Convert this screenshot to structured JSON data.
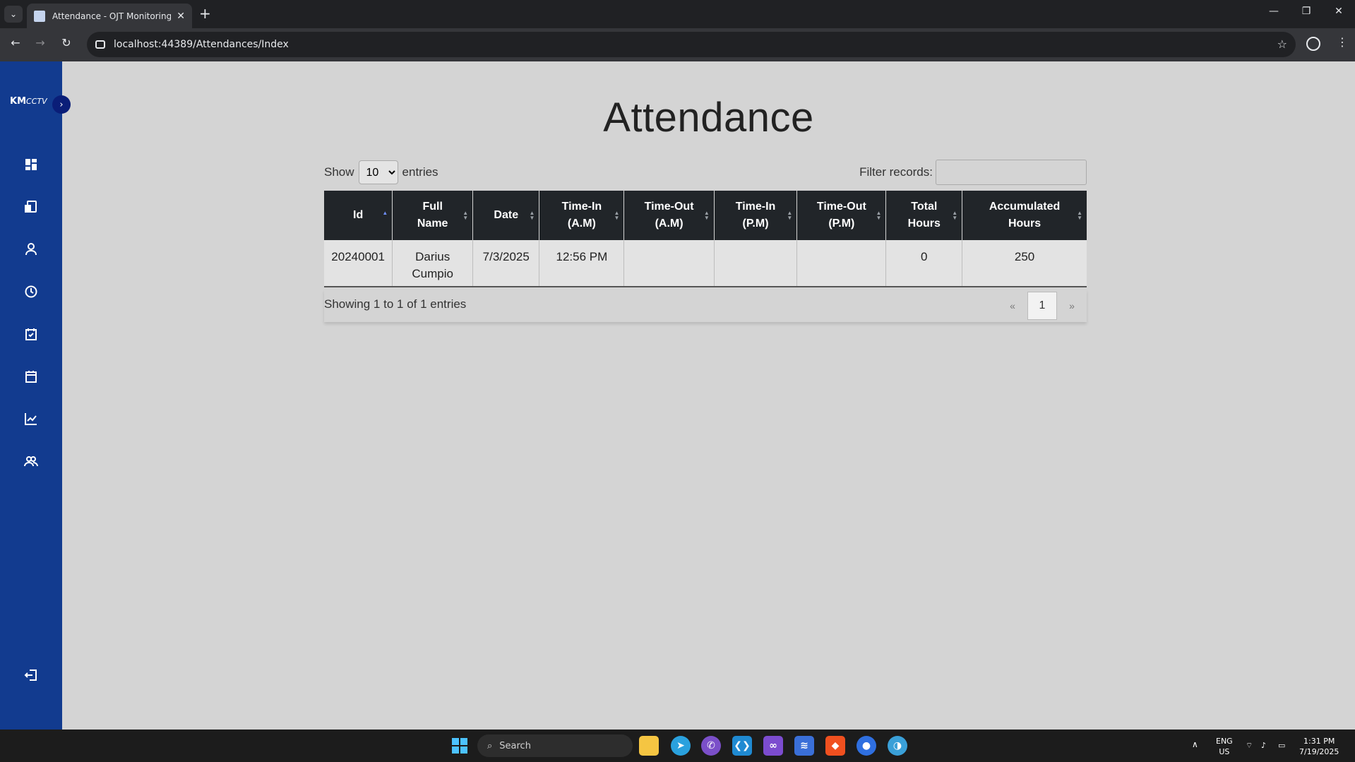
{
  "browser": {
    "tab_title": "Attendance - OJT Monitoring S",
    "url": "localhost:44389/Attendances/Index",
    "new_tab": "+",
    "tab_close": "✕"
  },
  "sidebar": {
    "logo_main": "KM",
    "logo_sub": "CCTV",
    "expand": "›",
    "items": [
      {
        "name": "dashboard-icon"
      },
      {
        "name": "report-icon"
      },
      {
        "name": "user-icon"
      },
      {
        "name": "clock-icon"
      },
      {
        "name": "calendar-check-icon"
      },
      {
        "name": "clipboard-icon"
      },
      {
        "name": "chart-line-icon"
      },
      {
        "name": "users-icon"
      },
      {
        "name": "logout-icon"
      }
    ],
    "bg_color": "#123b8f"
  },
  "page": {
    "title": "Attendance",
    "show_label": "Show",
    "entries_label": "entries",
    "length_value": "10",
    "filter_label": "Filter records:",
    "filter_value": "",
    "info": "Showing 1 to 1 of 1 entries"
  },
  "table": {
    "headers": [
      [
        "Id"
      ],
      [
        "Full",
        "Name"
      ],
      [
        "Date"
      ],
      [
        "Time-In",
        "(A.M)"
      ],
      [
        "Time-Out",
        "(A.M)"
      ],
      [
        "Time-In",
        "(P.M)"
      ],
      [
        "Time-Out",
        "(P.M)"
      ],
      [
        "Total",
        "Hours"
      ],
      [
        "Accumulated",
        "Hours"
      ]
    ],
    "rows": [
      {
        "id": "20240001",
        "full_name_1": "Darius",
        "full_name_2": "Cumpio",
        "date": "7/3/2025",
        "time_in_am": "12:56 PM",
        "time_out_am": "",
        "time_in_pm": "",
        "time_out_pm": "",
        "total_hours": "0",
        "accumulated_hours": "250"
      }
    ]
  },
  "pagination": {
    "prev": "«",
    "current": "1",
    "next": "»"
  },
  "taskbar": {
    "search": "Search",
    "lang_1": "ENG",
    "lang_2": "US",
    "time": "1:31 PM",
    "date": "7/19/2025"
  }
}
